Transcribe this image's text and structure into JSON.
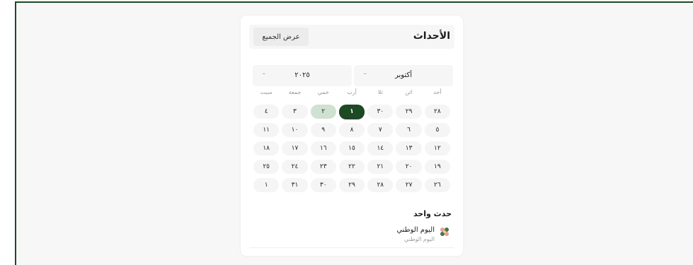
{
  "widget": {
    "title": "الأحداث",
    "view_all_label": "عرض الجميع"
  },
  "filters": {
    "month": "أكتوبر",
    "year": "٢٠٢٥"
  },
  "calendar": {
    "weekdays": [
      "أحد",
      "اثن",
      "ثلا",
      "أرب",
      "خمي",
      "جمعة",
      "سبت"
    ],
    "weeks": [
      [
        "٢٨",
        "٢٩",
        "٣٠",
        "١",
        "٢",
        "٣",
        "٤"
      ],
      [
        "٥",
        "٦",
        "٧",
        "٨",
        "٩",
        "١٠",
        "١١"
      ],
      [
        "١٢",
        "١٣",
        "١٤",
        "١٥",
        "١٦",
        "١٧",
        "١٨"
      ],
      [
        "١٩",
        "٢٠",
        "٢١",
        "٢٢",
        "٢٣",
        "٢٤",
        "٢٥"
      ],
      [
        "٢٦",
        "٢٧",
        "٢٨",
        "٢٩",
        "٣٠",
        "٣١",
        "١"
      ]
    ],
    "today": "١",
    "event_days": [
      "٢"
    ],
    "colors": {
      "today": "#1c4a23",
      "event": "#cfe1d0"
    }
  },
  "events": {
    "section_title": "حدث واحد",
    "items": [
      {
        "name": "اليوم الوطني",
        "subtitle": "اليوم الوطني",
        "icon": "flower-icon"
      }
    ]
  }
}
